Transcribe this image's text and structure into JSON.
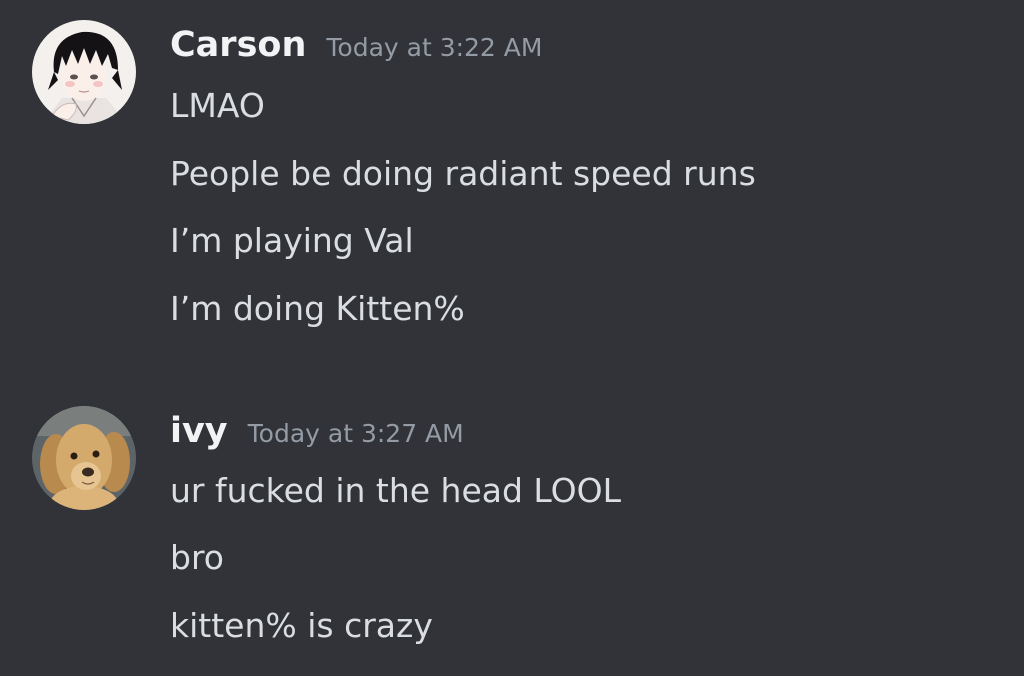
{
  "messages": [
    {
      "author": "Carson",
      "timestamp": "Today at 3:22 AM",
      "avatar_icon": "anime-boy-avatar",
      "lines": [
        "LMAO",
        "People be doing radiant speed runs",
        "I’m playing Val",
        "I’m doing Kitten%"
      ]
    },
    {
      "author": "ivy",
      "timestamp": "Today at 3:27 AM",
      "avatar_icon": "golden-retriever-avatar",
      "lines": [
        "ur fucked in the head LOOL",
        "bro",
        "kitten% is crazy"
      ]
    }
  ],
  "colors": {
    "background": "#313338",
    "username": "#f2f3f5",
    "timestamp": "#949ba4",
    "message_text": "#dbdee1"
  }
}
